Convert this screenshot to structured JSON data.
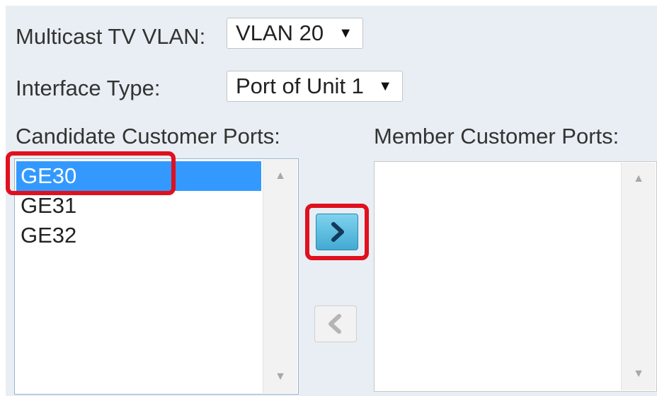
{
  "multicast_vlan": {
    "label": "Multicast TV VLAN:",
    "selected": "VLAN 20"
  },
  "interface_type": {
    "label": "Interface Type:",
    "selected": "Port of Unit 1"
  },
  "candidate_ports": {
    "label": "Candidate Customer Ports:",
    "items": [
      "GE30",
      "GE31",
      "GE32"
    ],
    "selected_index": 0
  },
  "member_ports": {
    "label": "Member Customer Ports:",
    "items": []
  },
  "buttons": {
    "add_icon": "chevron-right-icon",
    "remove_icon": "chevron-left-icon"
  },
  "colors": {
    "highlight": "#e0101e",
    "selection": "#3399ff",
    "add_button": "#43a9d3",
    "panel_bg": "#e8eef3"
  }
}
